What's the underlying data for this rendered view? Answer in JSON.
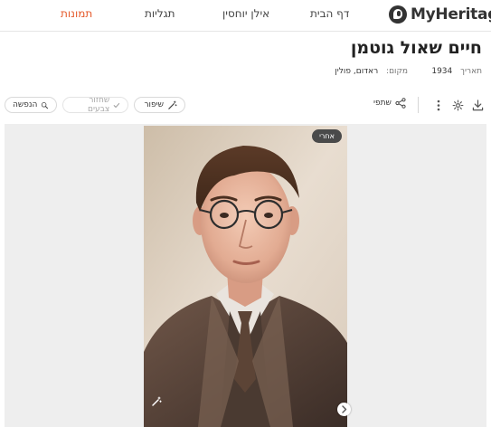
{
  "nav": {
    "logo_text": "MyHeritage",
    "items": [
      {
        "label": "דף הבית",
        "active": false
      },
      {
        "label": "אילן יוחסין",
        "active": false
      },
      {
        "label": "תגליות",
        "active": false
      },
      {
        "label": "תמונות",
        "active": true
      }
    ],
    "accent_color": "#e55a2b"
  },
  "photo_info": {
    "title": "חיים שאול גוטמן",
    "date_label": "תאריך",
    "date_value": "1934",
    "place_label": "מקום:",
    "place_value": "ראדום, פולין"
  },
  "toolbar": {
    "icons": [
      "download-icon",
      "gear-icon",
      "more-vertical-icon"
    ],
    "share_label": "שתפי",
    "enhance_label": "שיפור",
    "color_restore_label": "שחזור צבעים",
    "animate_label": "הנפשה"
  },
  "viewer": {
    "badge_label": "אחרי"
  }
}
